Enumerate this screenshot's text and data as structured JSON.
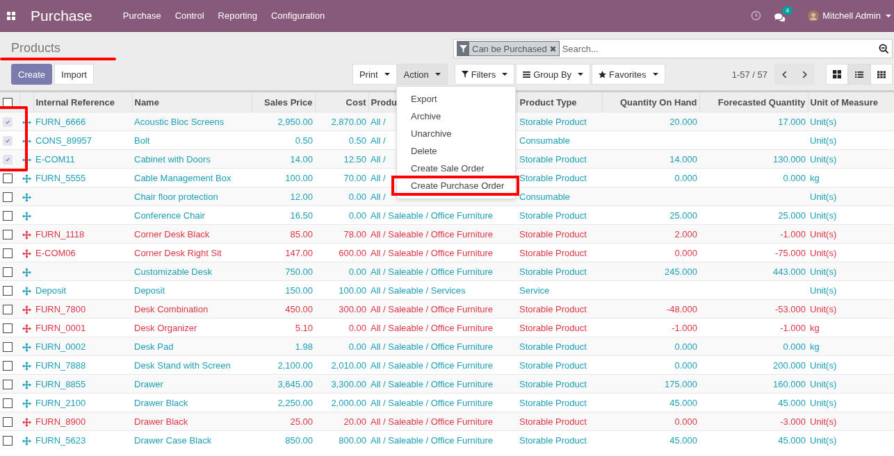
{
  "navbar": {
    "app_name": "Purchase",
    "menus": [
      "Purchase",
      "Control",
      "Reporting",
      "Configuration"
    ],
    "message_count": "4",
    "user": "Mitchell Admin"
  },
  "breadcrumb": {
    "title": "Products",
    "underlined": true
  },
  "buttons": [
    "Create",
    "Import"
  ],
  "action_buttons": [
    {
      "label": "Print",
      "open": false
    },
    {
      "label": "Action",
      "open": true
    }
  ],
  "search": {
    "facet": "Can be Purchased",
    "placeholder": "Search..."
  },
  "search_buttons": [
    {
      "label": "Filters",
      "kind": "filter"
    },
    {
      "label": "Group By",
      "kind": "group"
    },
    {
      "label": "Favorites",
      "kind": "star"
    }
  ],
  "pager": "1-57 / 57",
  "views": [
    {
      "kind": "kanban",
      "selected": false
    },
    {
      "kind": "list",
      "selected": true
    },
    {
      "kind": "grid",
      "selected": false
    }
  ],
  "action_menu": [
    {
      "label": "Export",
      "highlighted": false
    },
    {
      "label": "Archive",
      "highlighted": false
    },
    {
      "label": "Unarchive",
      "highlighted": false
    },
    {
      "label": "Delete",
      "highlighted": false
    },
    {
      "label": "Create Sale Order",
      "highlighted": false
    },
    {
      "label": "Create Purchase Order",
      "highlighted": true
    }
  ],
  "table": {
    "selection_highlighted": true,
    "all_selected": false,
    "columns": [
      "Internal Reference",
      "Name",
      "Sales Price",
      "Cost",
      "Produ",
      "Product Type",
      "Quantity On Hand",
      "Forecasted Quantity",
      "Unit of Measure"
    ],
    "rows": [
      {
        "selected": true,
        "warning": false,
        "cells": [
          "FURN_6666",
          "Acoustic Bloc Screens",
          "2,950.00",
          "2,870.00",
          "All /",
          "Storable Product",
          "20.000",
          "17.000",
          "Unit(s)"
        ]
      },
      {
        "selected": true,
        "warning": false,
        "cells": [
          "CONS_89957",
          "Bolt",
          "0.50",
          "0.50",
          "All /",
          "Consumable",
          "",
          "",
          "Unit(s)"
        ]
      },
      {
        "selected": true,
        "warning": false,
        "cells": [
          "E-COM11",
          "Cabinet with Doors",
          "14.00",
          "12.50",
          "All /",
          "Storable Product",
          "14.000",
          "130.000",
          "Unit(s)"
        ]
      },
      {
        "selected": false,
        "warning": false,
        "cells": [
          "FURN_5555",
          "Cable Management Box",
          "100.00",
          "70.00",
          "All /",
          "Storable Product",
          "0.000",
          "0.000",
          "kg"
        ]
      },
      {
        "selected": false,
        "warning": false,
        "cells": [
          "",
          "Chair floor protection",
          "12.00",
          "0.00",
          "All /",
          "Consumable",
          "",
          "",
          "Unit(s)"
        ]
      },
      {
        "selected": false,
        "warning": false,
        "cells": [
          "",
          "Conference Chair",
          "16.50",
          "0.00",
          "All / Saleable / Office Furniture",
          "Storable Product",
          "25.000",
          "25.000",
          "Unit(s)"
        ]
      },
      {
        "selected": false,
        "warning": true,
        "cells": [
          "FURN_1118",
          "Corner Desk Black",
          "85.00",
          "78.00",
          "All / Saleable / Office Furniture",
          "Storable Product",
          "2.000",
          "-1.000",
          "Unit(s)"
        ]
      },
      {
        "selected": false,
        "warning": true,
        "cells": [
          "E-COM06",
          "Corner Desk Right Sit",
          "147.00",
          "600.00",
          "All / Saleable / Office Furniture",
          "Storable Product",
          "0.000",
          "-75.000",
          "Unit(s)"
        ]
      },
      {
        "selected": false,
        "warning": false,
        "cells": [
          "",
          "Customizable Desk",
          "750.00",
          "0.00",
          "All / Saleable / Office Furniture",
          "Storable Product",
          "245.000",
          "443.000",
          "Unit(s)"
        ]
      },
      {
        "selected": false,
        "warning": false,
        "cells": [
          "Deposit",
          "Deposit",
          "150.00",
          "100.00",
          "All / Saleable / Services",
          "Service",
          "",
          "",
          "Unit(s)"
        ]
      },
      {
        "selected": false,
        "warning": true,
        "cells": [
          "FURN_7800",
          "Desk Combination",
          "450.00",
          "300.00",
          "All / Saleable / Office Furniture",
          "Storable Product",
          "-48.000",
          "-53.000",
          "Unit(s)"
        ]
      },
      {
        "selected": false,
        "warning": true,
        "cells": [
          "FURN_0001",
          "Desk Organizer",
          "5.10",
          "0.00",
          "All / Saleable / Office Furniture",
          "Storable Product",
          "-1.000",
          "-1.000",
          "kg"
        ]
      },
      {
        "selected": false,
        "warning": false,
        "cells": [
          "FURN_0002",
          "Desk Pad",
          "1.98",
          "0.00",
          "All / Saleable / Office Furniture",
          "Storable Product",
          "0.000",
          "0.000",
          "kg"
        ]
      },
      {
        "selected": false,
        "warning": false,
        "cells": [
          "FURN_7888",
          "Desk Stand with Screen",
          "2,100.00",
          "2,010.00",
          "All / Saleable / Office Furniture",
          "Storable Product",
          "0.000",
          "200.000",
          "Unit(s)"
        ]
      },
      {
        "selected": false,
        "warning": false,
        "cells": [
          "FURN_8855",
          "Drawer",
          "3,645.00",
          "3,300.00",
          "All / Saleable / Office Furniture",
          "Storable Product",
          "175.000",
          "160.000",
          "Unit(s)"
        ]
      },
      {
        "selected": false,
        "warning": false,
        "cells": [
          "FURN_2100",
          "Drawer Black",
          "2,250.00",
          "2,000.00",
          "All / Saleable / Office Furniture",
          "Storable Product",
          "45.000",
          "45.000",
          "Unit(s)"
        ]
      },
      {
        "selected": false,
        "warning": true,
        "cells": [
          "FURN_8900",
          "Drawer Black",
          "25.00",
          "20.00",
          "All / Saleable / Office Furniture",
          "Storable Product",
          "0.000",
          "-3.000",
          "Unit(s)"
        ]
      },
      {
        "selected": false,
        "warning": false,
        "cells": [
          "FURN_5623",
          "Drawer Case Black",
          "850.00",
          "800.00",
          "All / Saleable / Office Furniture",
          "Storable Product",
          "45.000",
          "45.000",
          "Unit(s)"
        ]
      }
    ]
  }
}
